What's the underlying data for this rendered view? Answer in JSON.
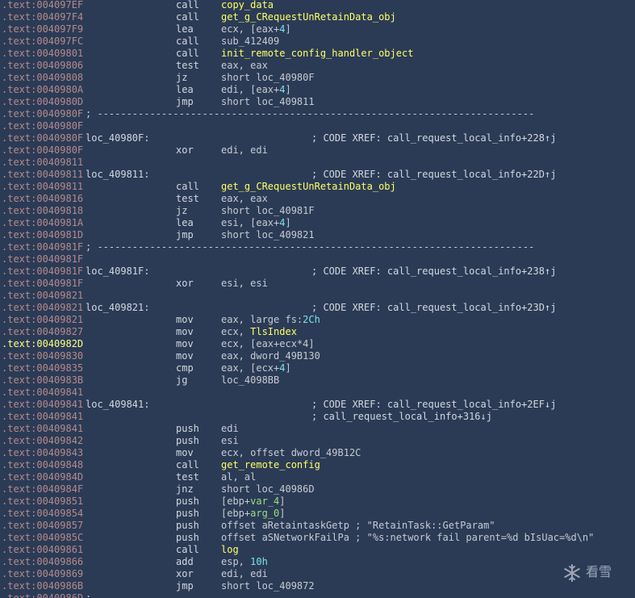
{
  "watermark": {
    "icon": "snowflake-icon",
    "text": "看雪"
  },
  "listing": [
    {
      "addr": ".text:004097EF",
      "mnem": "call",
      "ops": [
        {
          "t": "copy_data",
          "c": "yel"
        }
      ]
    },
    {
      "addr": ".text:004097F4",
      "mnem": "call",
      "ops": [
        {
          "t": "get_g_CRequestUnRetainData_obj",
          "c": "yel"
        }
      ]
    },
    {
      "addr": ".text:004097F9",
      "mnem": "lea",
      "ops": [
        {
          "t": "ecx, [eax+"
        },
        {
          "t": "4",
          "c": "cy"
        },
        {
          "t": "]"
        }
      ]
    },
    {
      "addr": ".text:004097FC",
      "mnem": "call",
      "ops": [
        {
          "t": "sub_412409"
        }
      ]
    },
    {
      "addr": ".text:00409801",
      "mnem": "call",
      "ops": [
        {
          "t": "init_remote_config_handler_object",
          "c": "yel"
        }
      ]
    },
    {
      "addr": ".text:00409806",
      "mnem": "test",
      "ops": [
        {
          "t": "eax, eax"
        }
      ]
    },
    {
      "addr": ".text:00409808",
      "mnem": "jz",
      "ops": [
        {
          "t": "short loc_40980F"
        }
      ]
    },
    {
      "addr": ".text:0040980A",
      "mnem": "lea",
      "ops": [
        {
          "t": "edi, [eax+"
        },
        {
          "t": "4",
          "c": "cy"
        },
        {
          "t": "]"
        }
      ]
    },
    {
      "addr": ".text:0040980D",
      "mnem": "jmp",
      "ops": [
        {
          "t": "short loc_409811"
        }
      ]
    },
    {
      "addr": ".text:0040980F",
      "sep": "; ---------------------------------------------------------------------------"
    },
    {
      "addr": ".text:0040980F"
    },
    {
      "addr": ".text:0040980F",
      "label": "loc_40980F:",
      "cmt": "; CODE XREF: call_request_local_info+228↑j"
    },
    {
      "addr": ".text:0040980F",
      "mnem": "xor",
      "ops": [
        {
          "t": "edi, edi"
        }
      ]
    },
    {
      "addr": ".text:00409811"
    },
    {
      "addr": ".text:00409811",
      "label": "loc_409811:",
      "cmt": "; CODE XREF: call_request_local_info+22D↑j"
    },
    {
      "addr": ".text:00409811",
      "mnem": "call",
      "ops": [
        {
          "t": "get_g_CRequestUnRetainData_obj",
          "c": "yel"
        }
      ]
    },
    {
      "addr": ".text:00409816",
      "mnem": "test",
      "ops": [
        {
          "t": "eax, eax"
        }
      ]
    },
    {
      "addr": ".text:00409818",
      "mnem": "jz",
      "ops": [
        {
          "t": "short loc_40981F"
        }
      ]
    },
    {
      "addr": ".text:0040981A",
      "mnem": "lea",
      "ops": [
        {
          "t": "esi, [eax+"
        },
        {
          "t": "4",
          "c": "cy"
        },
        {
          "t": "]"
        }
      ]
    },
    {
      "addr": ".text:0040981D",
      "mnem": "jmp",
      "ops": [
        {
          "t": "short loc_409821"
        }
      ]
    },
    {
      "addr": ".text:0040981F",
      "sep": "; ---------------------------------------------------------------------------"
    },
    {
      "addr": ".text:0040981F"
    },
    {
      "addr": ".text:0040981F",
      "label": "loc_40981F:",
      "cmt": "; CODE XREF: call_request_local_info+238↑j"
    },
    {
      "addr": ".text:0040981F",
      "mnem": "xor",
      "ops": [
        {
          "t": "esi, esi"
        }
      ]
    },
    {
      "addr": ".text:00409821"
    },
    {
      "addr": ".text:00409821",
      "label": "loc_409821:",
      "cmt": "; CODE XREF: call_request_local_info+23D↑j"
    },
    {
      "addr": ".text:00409821",
      "mnem": "mov",
      "ops": [
        {
          "t": "eax, large fs:"
        },
        {
          "t": "2Ch",
          "c": "cy"
        }
      ]
    },
    {
      "addr": ".text:00409827",
      "mnem": "mov",
      "ops": [
        {
          "t": "ecx, "
        },
        {
          "t": "TlsIndex",
          "c": "yel"
        }
      ]
    },
    {
      "addr": ".text:0040982D",
      "hl": true,
      "mnem": "mov",
      "ops": [
        {
          "t": "ecx, [eax+ecx*4]"
        }
      ]
    },
    {
      "addr": ".text:00409830",
      "mnem": "mov",
      "ops": [
        {
          "t": "eax, dword_49B130"
        }
      ]
    },
    {
      "addr": ".text:00409835",
      "mnem": "cmp",
      "ops": [
        {
          "t": "eax, [ecx+"
        },
        {
          "t": "4",
          "c": "cy"
        },
        {
          "t": "]"
        }
      ]
    },
    {
      "addr": ".text:0040983B",
      "mnem": "jg",
      "ops": [
        {
          "t": "loc_4098BB"
        }
      ]
    },
    {
      "addr": ".text:00409841"
    },
    {
      "addr": ".text:00409841",
      "label": "loc_409841:",
      "cmt": "; CODE XREF: call_request_local_info+2EF↓j"
    },
    {
      "addr": ".text:00409841",
      "cmt": "; call_request_local_info+316↓j"
    },
    {
      "addr": ".text:00409841",
      "mnem": "push",
      "ops": [
        {
          "t": "edi"
        }
      ]
    },
    {
      "addr": ".text:00409842",
      "mnem": "push",
      "ops": [
        {
          "t": "esi"
        }
      ]
    },
    {
      "addr": ".text:00409843",
      "mnem": "mov",
      "ops": [
        {
          "t": "ecx, offset dword_49B12C"
        }
      ]
    },
    {
      "addr": ".text:00409848",
      "mnem": "call",
      "ops": [
        {
          "t": "get_remote_config",
          "c": "yel"
        }
      ]
    },
    {
      "addr": ".text:0040984D",
      "mnem": "test",
      "ops": [
        {
          "t": "al, al"
        }
      ]
    },
    {
      "addr": ".text:0040984F",
      "mnem": "jnz",
      "ops": [
        {
          "t": "short loc_40986D"
        }
      ]
    },
    {
      "addr": ".text:00409851",
      "mnem": "push",
      "ops": [
        {
          "t": "[ebp+"
        },
        {
          "t": "var_4",
          "c": "gr"
        },
        {
          "t": "]"
        }
      ]
    },
    {
      "addr": ".text:00409854",
      "mnem": "push",
      "ops": [
        {
          "t": "[ebp+"
        },
        {
          "t": "arg_0",
          "c": "gr"
        },
        {
          "t": "]"
        }
      ]
    },
    {
      "addr": ".text:00409857",
      "mnem": "push",
      "ops": [
        {
          "t": "offset aRetaintaskGetp ; \"RetainTask::GetParam\""
        }
      ]
    },
    {
      "addr": ".text:0040985C",
      "mnem": "push",
      "ops": [
        {
          "t": "offset aSNetworkFailPa ; \"%s:network fail parent=%d bIsUac=%d\\n\""
        }
      ]
    },
    {
      "addr": ".text:00409861",
      "mnem": "call",
      "ops": [
        {
          "t": "log",
          "c": "yel"
        }
      ]
    },
    {
      "addr": ".text:00409866",
      "mnem": "add",
      "ops": [
        {
          "t": "esp, "
        },
        {
          "t": "10h",
          "c": "cy"
        }
      ]
    },
    {
      "addr": ".text:00409869",
      "mnem": "xor",
      "ops": [
        {
          "t": "edi, edi"
        }
      ]
    },
    {
      "addr": ".text:0040986B",
      "mnem": "jmp",
      "ops": [
        {
          "t": "short loc_409872"
        }
      ]
    },
    {
      "addr": ".text:0040986D",
      "sep": "; -"
    }
  ]
}
